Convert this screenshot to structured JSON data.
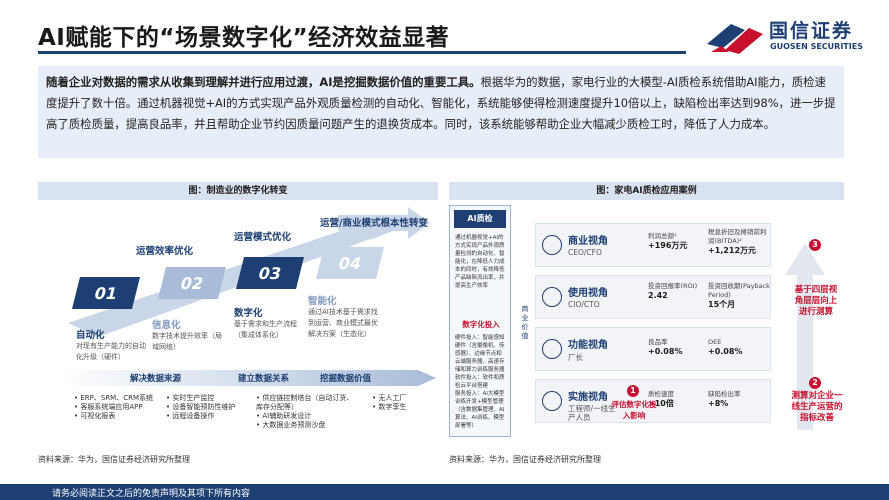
{
  "header": {
    "title": "AI赋能下的“场景数字化”经济效益显著",
    "logo_cn": "国信证券",
    "logo_en": "GUOSEN SECURITIES"
  },
  "summary": {
    "bold_lead": "随着企业对数据的需求从收集到理解并进行应用过渡，AI是挖掘数据价值的重要工具。",
    "body": "根据华为的数据，家电行业的大模型-AI质检系统借助AI能力，质检速度提升了数十倍。通过机器视觉+AI的方式实现产品外观质量检测的自动化、智能化，系统能够使得检测速度提升10倍以上，缺陷检出率达到98%，进一步提高了质检质量，提高良品率，并且帮助企业节约因质量问题产生的退换货成本。同时，该系统能够帮助企业大幅减少质检工时，降低了人力成本。"
  },
  "left_figure": {
    "title": "图：制造业的数字化转变",
    "steps": [
      {
        "num": "01",
        "heading": "自动化",
        "desc": "对现有生产能力的自动化升级（硬件）"
      },
      {
        "num": "02",
        "heading": "信息化",
        "desc": "数字技术提升效率（局域网络）"
      },
      {
        "num": "03",
        "heading": "数字化",
        "desc": "基于需求和生产流程（集成体系化）"
      },
      {
        "num": "04",
        "heading": "智能化",
        "desc": "通过AI技术基于需求找到运营、商业模式最优解决方案（生态化）"
      }
    ],
    "stage_labels": [
      "运营效率优化",
      "运营模式优化",
      "运营/商业模式根本性转变"
    ],
    "band_labels": [
      "解决数据来源",
      "建立数据关系",
      "挖掘数据价值"
    ],
    "columns": [
      [
        "ERP、SRM、CRM系统",
        "客服系统端应用APP",
        "可视化报表"
      ],
      [
        "实时生产监控",
        "设备智能预防性维护",
        "远程设备操作"
      ],
      [
        "供应链控制塔台（自动订货、库存分配等）",
        "AI辅助研发设计",
        "大数据业务预测沙盘"
      ],
      [
        "无人工厂",
        "数字孪生"
      ]
    ],
    "source": "资料来源：华为，国信证券经济研究所整理"
  },
  "right_figure": {
    "title": "图：家电AI质检应用案例",
    "ai_box": {
      "head": "AI质检",
      "text": "通过机器视觉+AI的方式实现产品外观质量检测的自动化、智能化，在降低人力成本的同时，有效降低产品缺陷流出率，并提高生产效率",
      "sub": "数字化投入",
      "detail": "硬件投入：智能感知硬件（含摄像机、传感器）、边缘节点和云端服务器、高速存储和算力训练服务器\n软件投入：软件和质检云平台搭建\n服务投入：AI大模型训练开发+模型管理（含数据集管理、AI算法、AI训练、模型部署等）"
    },
    "vertical_label": "商业价值",
    "views": [
      {
        "name": "商业视角",
        "role": "CEO/CFO",
        "m1_label": "利润总额¹",
        "m1_value": "+196万元",
        "m2_label": "税息折旧及摊销前利润(BITDA)²",
        "m2_value": "+1,212万元"
      },
      {
        "name": "使用视角",
        "role": "CIO/CTO",
        "m1_label": "投资回报率(ROI)",
        "m1_value": "2.42",
        "m2_label": "投资回收期(Payback Period)",
        "m2_value": "15个月"
      },
      {
        "name": "功能视角",
        "role": "厂长",
        "m1_label": "良品率",
        "m1_value": "+0.08%",
        "m2_label": "OEE",
        "m2_value": "+0.08%"
      },
      {
        "name": "实施视角",
        "role": "工程师/一线生产人员",
        "m1_label": "质检速度",
        "m1_value": ">10倍",
        "m2_label": "缺陷检出率",
        "m2_value": "+8%"
      }
    ],
    "badges": [
      {
        "num": "1",
        "label": "评估数字化投入影响"
      },
      {
        "num": "2",
        "label": "测算对企业一线生产运营的指标改善"
      },
      {
        "num": "3",
        "label": "基于四层视角层层向上进行测算"
      }
    ],
    "source": "资料来源：华为，国信证券经济研究所整理"
  },
  "footer": {
    "disclaimer": "请务必阅读正文之后的免责声明及其项下所有内容"
  },
  "colors": {
    "navy": "#1d3f73",
    "red": "#c8102e",
    "light_panel": "#e8eef7"
  }
}
